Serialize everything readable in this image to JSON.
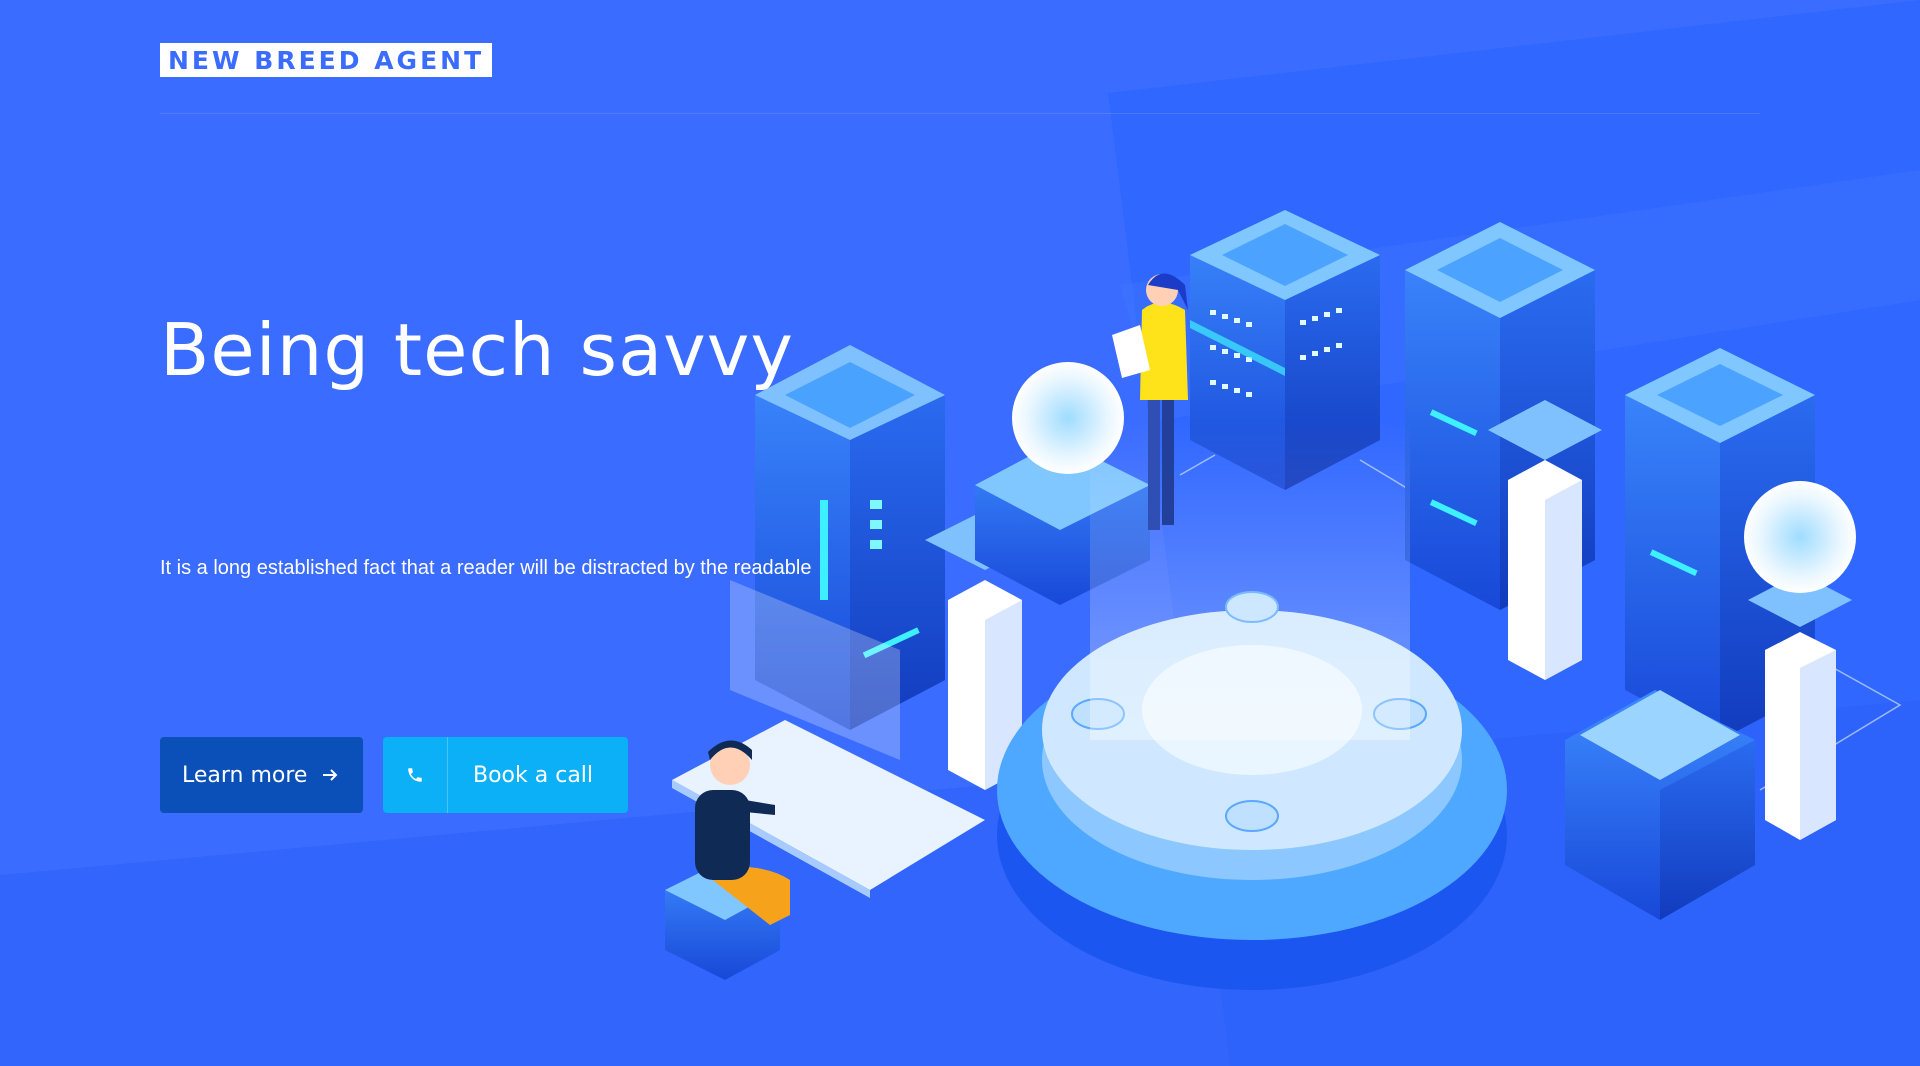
{
  "brand": {
    "name": "NEW BREED AGENT"
  },
  "hero": {
    "title": "Being tech savvy",
    "description": "It is a long established fact that a reader will be distracted by the readable"
  },
  "actions": {
    "learn_more": "Learn more",
    "book_call": "Book a call"
  },
  "icons": {
    "arrow": "arrow-right-icon",
    "phone": "phone-icon"
  },
  "colors": {
    "background": "#3a6cff",
    "logo_text": "#3a6cff",
    "primary_button": "#0b50b8",
    "secondary_button": "#0bb0f7",
    "text": "#ffffff"
  }
}
